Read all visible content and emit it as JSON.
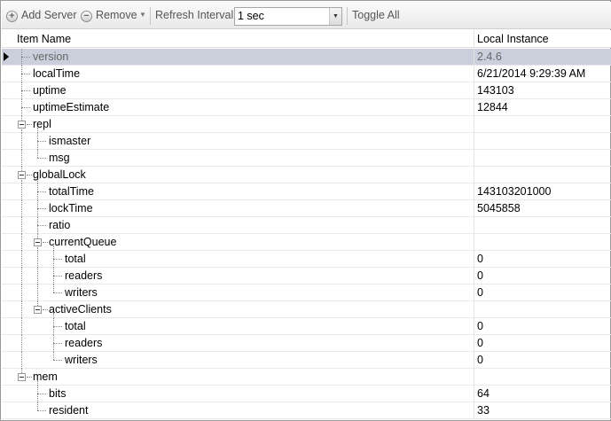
{
  "toolbar": {
    "add_server": "Add Server",
    "remove": "Remove",
    "refresh_label": "Refresh Interval:",
    "refresh_value": "1 sec",
    "toggle_all": "Toggle All"
  },
  "columns": {
    "name": "Item Name",
    "value": "Local Instance"
  },
  "rows": [
    {
      "name": "version",
      "value": "2.4.6"
    },
    {
      "name": "localTime",
      "value": "6/21/2014 9:29:39 AM"
    },
    {
      "name": "uptime",
      "value": "143103"
    },
    {
      "name": "uptimeEstimate",
      "value": "12844"
    },
    {
      "name": "repl",
      "value": ""
    },
    {
      "name": "ismaster",
      "value": ""
    },
    {
      "name": "msg",
      "value": ""
    },
    {
      "name": "globalLock",
      "value": ""
    },
    {
      "name": "totalTime",
      "value": "143103201000"
    },
    {
      "name": "lockTime",
      "value": "5045858"
    },
    {
      "name": "ratio",
      "value": ""
    },
    {
      "name": "currentQueue",
      "value": ""
    },
    {
      "name": "total",
      "value": "0"
    },
    {
      "name": "readers",
      "value": "0"
    },
    {
      "name": "writers",
      "value": "0"
    },
    {
      "name": "activeClients",
      "value": ""
    },
    {
      "name": "total",
      "value": "0"
    },
    {
      "name": "readers",
      "value": "0"
    },
    {
      "name": "writers",
      "value": "0"
    },
    {
      "name": "mem",
      "value": ""
    },
    {
      "name": "bits",
      "value": "64"
    },
    {
      "name": "resident",
      "value": "33"
    }
  ]
}
